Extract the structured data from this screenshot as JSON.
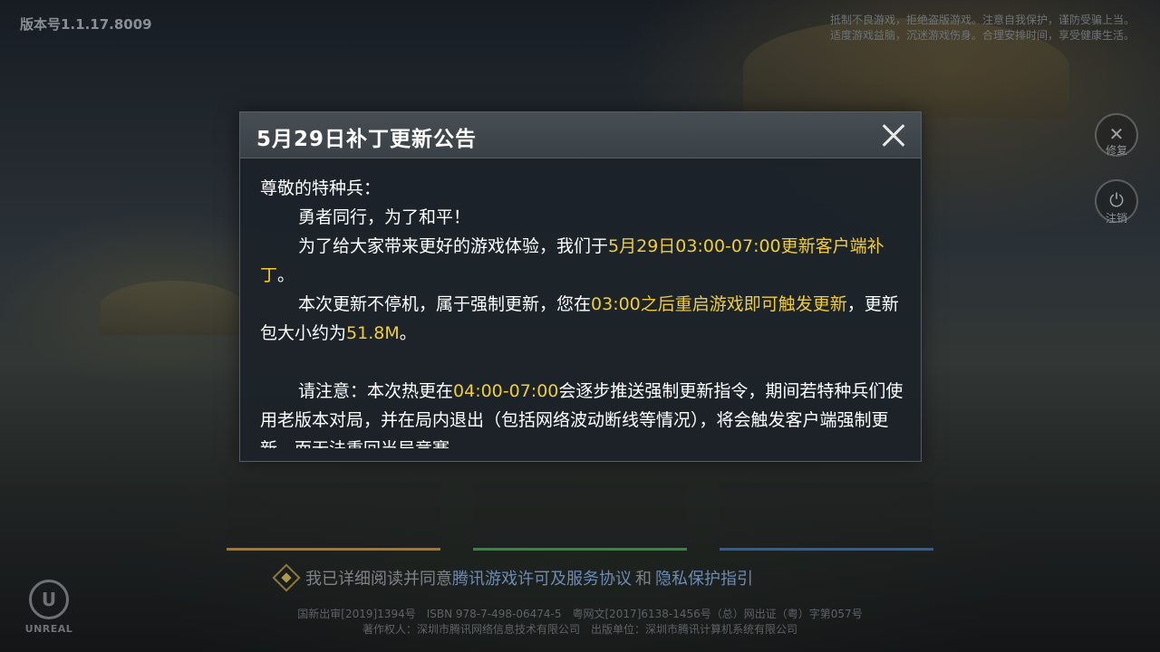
{
  "version": "版本号1.1.17.8009",
  "health_notice": [
    "抵制不良游戏，拒绝盗版游戏。注意自我保护，谨防受骗上当。",
    "适度游戏益脑，沉迷游戏伤身。合理安排时间，享受健康生活。"
  ],
  "side": {
    "repair_label": "修复",
    "logout_label": "注销"
  },
  "modal": {
    "title": "5月29日补丁更新公告",
    "greeting": "尊敬的特种兵：",
    "line1": "勇者同行，为了和平！",
    "p2_a": "为了给大家带来更好的游戏体验，我们于",
    "p2_hl": "5月29日03:00-07:00更新客户端补丁",
    "p2_b": "。",
    "p3_a": "本次更新不停机，属于强制更新，您在",
    "p3_hl1": "03:00之后重启游戏即可触发更新",
    "p3_b": "，更新包大小约为",
    "p3_hl2": "51.8M",
    "p3_c": "。",
    "p4_a": "请注意：本次热更在",
    "p4_hl": "04:00-07:00",
    "p4_b": "会逐步推送强制更新指令，期间若特种兵们使用老版本对局，并在局内退出（包括网络波动断线等情况），将会触发客户端强制更新，而无法重回当局竞赛。"
  },
  "agreement": {
    "prefix": "我已详细阅读并同意",
    "link1": "腾讯游戏许可及服务协议",
    "and": "和",
    "link2": "隐私保护指引"
  },
  "footer": {
    "line1": "国新出审[2019]1394号　ISBN 978-7-498-06474-5　粤网文[2017]6138-1456号（总）网出证（粤）字第057号",
    "line2": "著作权人：深圳市腾讯网络信息技术有限公司　出版单位：深圳市腾讯计算机系统有限公司"
  },
  "engine_logo": "UNREAL"
}
